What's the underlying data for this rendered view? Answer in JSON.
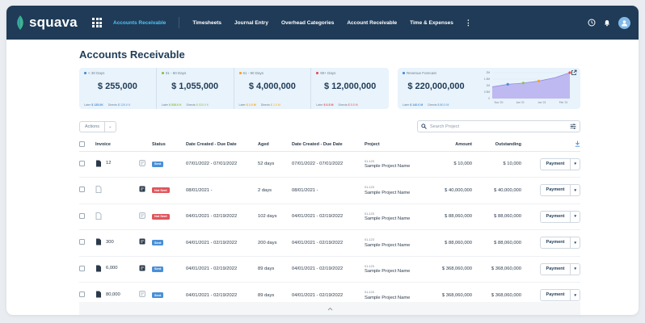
{
  "brand": {
    "name": "squava",
    "accent": "#4fc3f7",
    "bar_color": "#1f3b57"
  },
  "nav": {
    "items": [
      {
        "label": "Accounts Receivable",
        "active": true
      },
      {
        "label": "Timesheets",
        "active": false
      },
      {
        "label": "Journal Entry",
        "active": false
      },
      {
        "label": "Overhead Categories",
        "active": false
      },
      {
        "label": "Account Receivable",
        "active": false
      },
      {
        "label": "Time & Expenses",
        "active": false
      }
    ],
    "more_label": "⋮"
  },
  "page": {
    "title": "Accounts Receivable"
  },
  "kpis": [
    {
      "label": "< 30 Days",
      "value": "$ 255,000",
      "color": "#4a8fd6",
      "later_label": "Later",
      "later_value": "$ 135.0K",
      "direct_label": "Directs",
      "direct_value": "$ 120.0 K",
      "later_color": "#4a8fd6",
      "direct_color": "#4a8fd6"
    },
    {
      "label": "31 - 60 Days",
      "value": "$ 1,055,000",
      "color": "#8bc34a",
      "later_label": "Later",
      "later_value": "$ 535.0 K",
      "direct_label": "Directs",
      "direct_value": "$ 520.0 K",
      "later_color": "#8bc34a",
      "direct_color": "#8bc34a"
    },
    {
      "label": "61 - 90 Days",
      "value": "$ 4,000,000",
      "color": "#f5a623",
      "later_label": "Later",
      "later_value": "$ 2.0 M",
      "direct_label": "Directs",
      "direct_value": "$ 2.0 M",
      "later_color": "#f5a623",
      "direct_color": "#f5a623"
    },
    {
      "label": "90+ Days",
      "value": "$ 12,000,000",
      "color": "#e0555c",
      "later_label": "Later",
      "later_value": "$ 6.5 M",
      "direct_label": "Directs",
      "direct_value": "$ 5.5 M",
      "later_color": "#e0555c",
      "direct_color": "#e0555c"
    }
  ],
  "forecast": {
    "label": "Revenue Forecast",
    "value": "$ 220,000,000",
    "later_label": "Later",
    "later_value": "$ 140.0 M",
    "direct_label": "Directs",
    "direct_value": "$ 80.0 M",
    "chart_data": {
      "type": "area",
      "x": [
        "Nov '20",
        "Jan '21",
        "Jun '21",
        "Feb '21"
      ],
      "values": [
        0.9,
        1.1,
        1.2,
        1.35,
        1.6,
        2.0
      ],
      "ylim": [
        0,
        2.0
      ],
      "yticks": [
        "2M",
        "1.5M",
        "1M",
        "0.5M",
        "0"
      ],
      "marker_colors": [
        "#4a8fd6",
        "#8bc34a",
        "#f5a623",
        "#e0555c"
      ]
    }
  },
  "toolbar": {
    "actions_label": "Actions",
    "search_placeholder": "Search Project"
  },
  "table": {
    "headers": {
      "invoice": "Invoice",
      "status": "Status",
      "created_due": "Date Created - Due Date",
      "aged": "Aged",
      "created_due2": "Date Created - Due Date",
      "project": "Project",
      "amount": "Amount",
      "outstanding": "Outstanding"
    },
    "rows": [
      {
        "invoice": "12",
        "has_file": true,
        "note_dark": false,
        "status": "Sent",
        "status_kind": "sent",
        "dates": "07/01/2022 - 07/01/2022",
        "aged": "52 days",
        "dates2": "07/01/2022 - 07/01/2022",
        "project_id": "01-123",
        "project": "Sample Project Name",
        "amount": "$ 10,000",
        "outstanding": "$ 10,000",
        "action": "Payment"
      },
      {
        "invoice": "",
        "has_file": false,
        "note_dark": true,
        "status": "Not Sent",
        "status_kind": "notsent",
        "dates": "08/01/2021 -",
        "aged": "2 days",
        "dates2": "08/01/2021 -",
        "project_id": "01-123",
        "project": "Sample Project Name",
        "amount": "$ 40,000,000",
        "outstanding": "$ 40,000,000",
        "action": "Payment"
      },
      {
        "invoice": "",
        "has_file": false,
        "note_dark": false,
        "status": "Not Sent",
        "status_kind": "notsent",
        "dates": "04/01/2021 - 02/19/2022",
        "aged": "102 days",
        "dates2": "04/01/2021 - 02/19/2022",
        "project_id": "01-123",
        "project": "Sample Project Name",
        "amount": "$ 88,060,000",
        "outstanding": "$ 88,060,000",
        "action": "Payment"
      },
      {
        "invoice": "300",
        "has_file": true,
        "note_dark": true,
        "status": "Sent",
        "status_kind": "sent",
        "dates": "04/01/2021 - 02/19/2022",
        "aged": "200 days",
        "dates2": "04/01/2021 - 02/19/2022",
        "project_id": "01-123",
        "project": "Sample Project Name",
        "amount": "$ 88,060,000",
        "outstanding": "$ 88,060,000",
        "action": "Payment"
      },
      {
        "invoice": "6,000",
        "has_file": true,
        "note_dark": true,
        "status": "Sent",
        "status_kind": "sent",
        "dates": "04/01/2021 - 02/19/2022",
        "aged": "89 days",
        "dates2": "04/01/2021 - 02/19/2022",
        "project_id": "01-123",
        "project": "Sample Project Name",
        "amount": "$ 368,060,000",
        "outstanding": "$ 368,060,000",
        "action": "Payment"
      },
      {
        "invoice": "80,000",
        "has_file": true,
        "note_dark": false,
        "status": "Sent",
        "status_kind": "sent",
        "dates": "04/01/2021 - 02/19/2022",
        "aged": "89 days",
        "dates2": "04/01/2021 - 02/19/2022",
        "project_id": "01-123",
        "project": "Sample Project Name",
        "amount": "$ 368,060,000",
        "outstanding": "$ 368,060,000",
        "action": "Payment"
      }
    ]
  }
}
